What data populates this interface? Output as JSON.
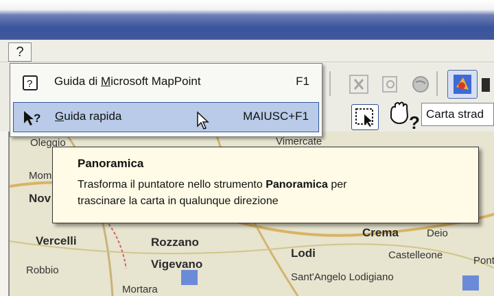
{
  "menu_bar": {
    "help_label": "?"
  },
  "help_menu": {
    "items": [
      {
        "label_pre": "Guida di ",
        "label_ul": "M",
        "label_post": "icrosoft MapPoint",
        "shortcut": "F1"
      },
      {
        "label_pre": "",
        "label_ul": "G",
        "label_post": "uida rapida",
        "shortcut": "MAIUSC+F1"
      }
    ]
  },
  "toolbar": {
    "map_style_value": "Carta strad"
  },
  "tooltip": {
    "title": "Panoramica",
    "line1_pre": "Trasforma il puntatore nello strumento ",
    "line1_bold": "Panoramica",
    "line1_post": " per",
    "line2": "trascinare la carta in qualunque direzione"
  },
  "map": {
    "places": [
      "Oleggio",
      "Vimercate",
      "Mom",
      "Nov",
      "Vercelli",
      "Rozzano",
      "Crema",
      "Lodi",
      "Castelleone",
      "Vigevano",
      "Robbio",
      "Sant'Angelo Lodigiano",
      "Mortara",
      "Pont",
      "Deio"
    ]
  },
  "colors": {
    "menu_highlight": "#b9cbe8",
    "tooltip_bg": "#fffbe6",
    "title_bar": "#3a559e"
  }
}
